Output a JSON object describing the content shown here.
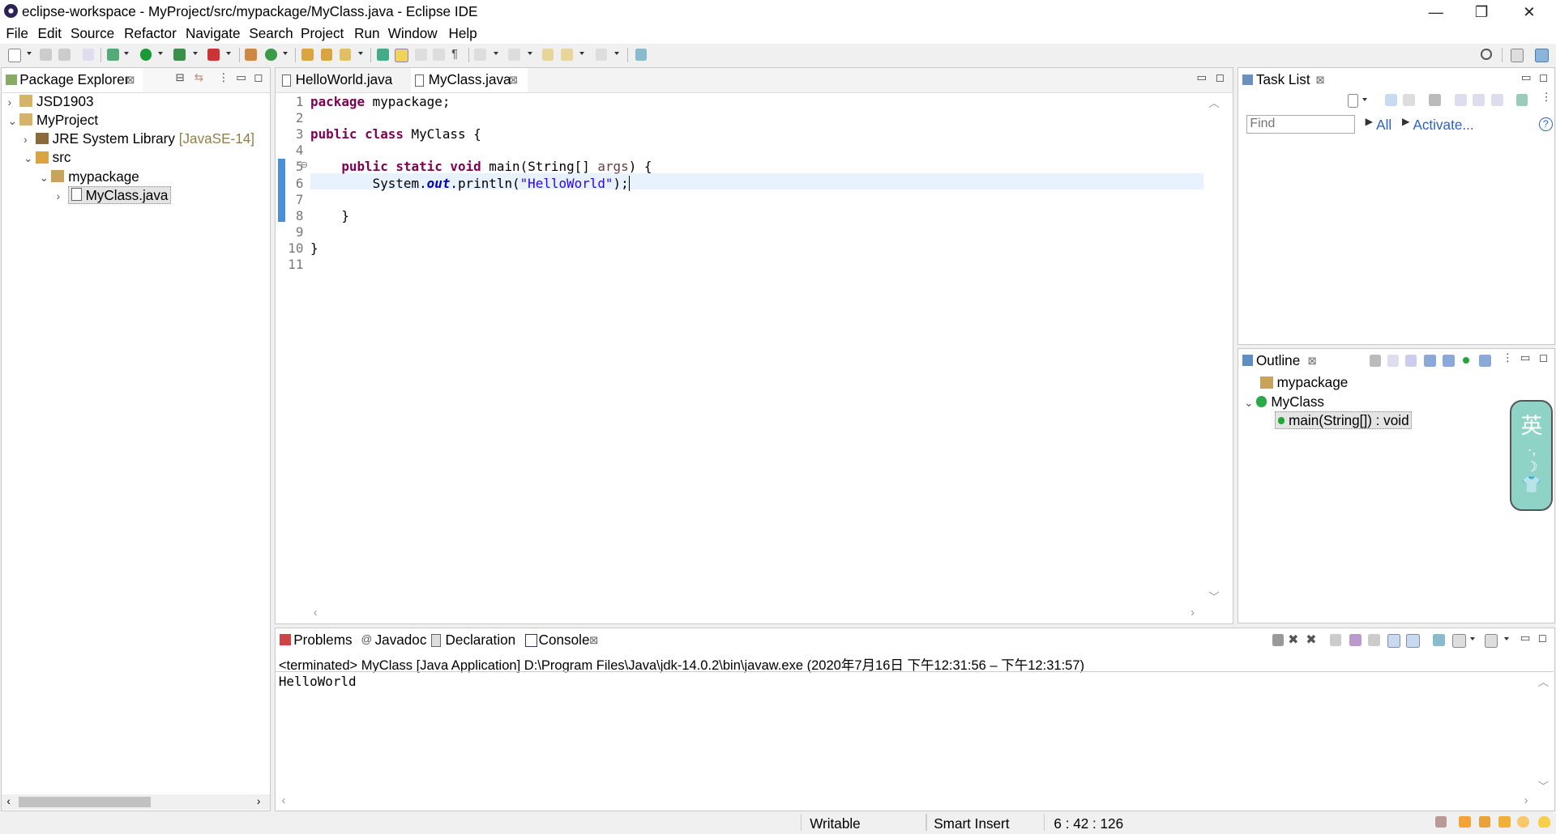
{
  "window": {
    "title": "eclipse-workspace - MyProject/src/mypackage/MyClass.java - Eclipse IDE",
    "minimize": "—",
    "restore": "❐",
    "close": "✕"
  },
  "menu": [
    "File",
    "Edit",
    "Source",
    "Refactor",
    "Navigate",
    "Search",
    "Project",
    "Run",
    "Window",
    "Help"
  ],
  "package_explorer": {
    "title": "Package Explorer",
    "tree": [
      {
        "arrow": "›",
        "label": "JSD1903",
        "extra": ""
      },
      {
        "arrow": "⌄",
        "label": "MyProject",
        "extra": ""
      },
      {
        "arrow": "›",
        "label": "JRE System Library",
        "extra": "[JavaSE-14]"
      },
      {
        "arrow": "⌄",
        "label": "src",
        "extra": ""
      },
      {
        "arrow": "⌄",
        "label": "mypackage",
        "extra": ""
      },
      {
        "arrow": "›",
        "label": "MyClass.java",
        "extra": ""
      }
    ]
  },
  "editor": {
    "tabs": [
      "HelloWorld.java",
      "MyClass.java"
    ],
    "line_numbers": [
      "1",
      "2",
      "3",
      "4",
      "5",
      "6",
      "7",
      "8",
      "9",
      "10",
      "11"
    ],
    "fold_marker": "⊖",
    "lines": {
      "l1_kw": "package",
      "l1_rest": " mypackage;",
      "l3_kw1": "public",
      "l3_kw2": "class",
      "l3_rest": " MyClass {",
      "l5_indent": "    ",
      "l5_kw1": "public",
      "l5_kw2": "static",
      "l5_kw3": "void",
      "l5_mid": " main(String[] ",
      "l5_param": "args",
      "l5_end": ") {",
      "l6_a": "        System.",
      "l6_field": "out",
      "l6_b": ".println(",
      "l6_str": "\"HelloWorld\"",
      "l6_c": ");",
      "l8": "    }",
      "l10": "}"
    }
  },
  "task_list": {
    "title": "Task List",
    "find_placeholder": "Find",
    "all_label": "All",
    "activate_label": "Activate...",
    "help": "?"
  },
  "outline": {
    "title": "Outline",
    "items": [
      "mypackage",
      "MyClass",
      "main(String[]) : void"
    ]
  },
  "bottom_tabs": [
    "Problems",
    "Javadoc",
    "Declaration",
    "Console"
  ],
  "console": {
    "header": "<terminated> MyClass [Java Application] D:\\Program Files\\Java\\jdk-14.0.2\\bin\\javaw.exe  (2020年7月16日 下午12:31:56 – 下午12:31:57)",
    "output": "HelloWorld"
  },
  "ime": {
    "char": "英"
  },
  "status": {
    "writable": "Writable",
    "insert_mode": "Smart Insert",
    "position": "6 : 42 : 126"
  },
  "colors": {
    "keyword": "#7f0055",
    "string": "#2a00ff",
    "field": "#0000c0",
    "current_line": "#e8f2fe",
    "ime_widget": "#8fd3c6"
  }
}
